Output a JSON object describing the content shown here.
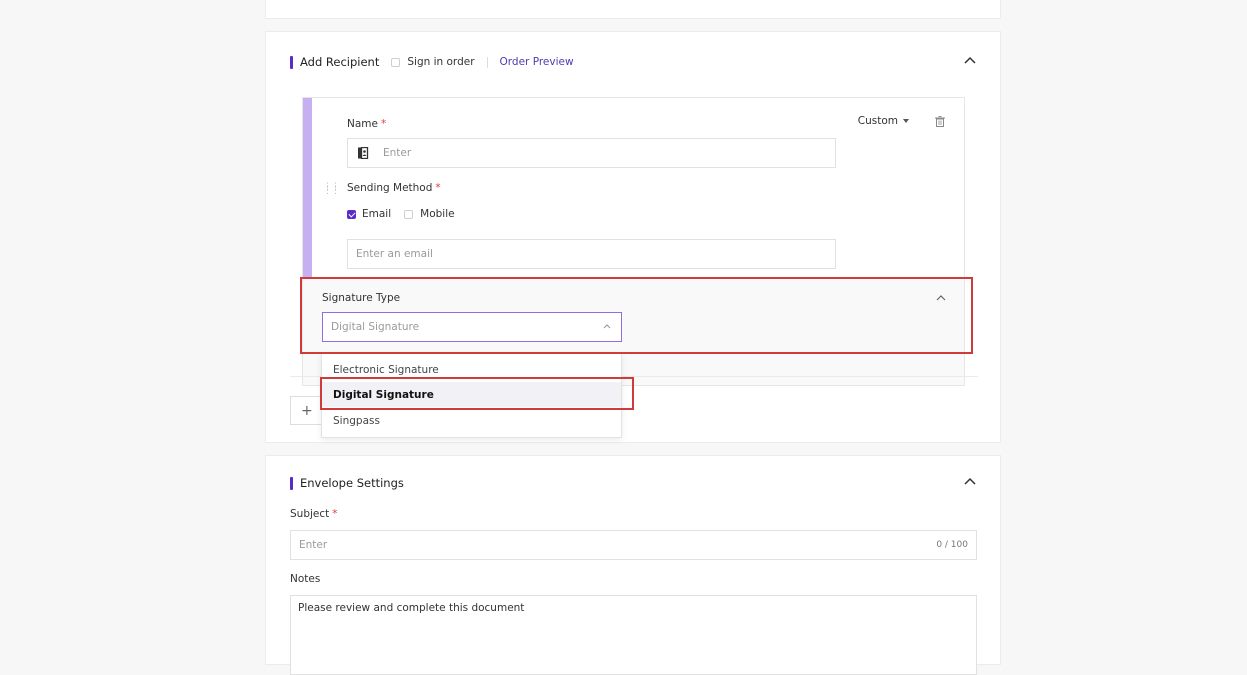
{
  "colors": {
    "accent": "#5b2bc9",
    "highlight": "#cf3a3a",
    "required": "#e23b3b",
    "stripe": "#c7b0f2"
  },
  "recipient_section": {
    "title": "Add Recipient",
    "sign_in_order_label": "Sign in order",
    "order_preview_link": "Order Preview",
    "recipient": {
      "role_dropdown": "Custom",
      "name_label": "Name",
      "name_placeholder": "Enter",
      "sending_method_label": "Sending Method",
      "methods": [
        {
          "label": "Email",
          "checked": true
        },
        {
          "label": "Mobile",
          "checked": false
        }
      ],
      "email_placeholder": "Enter an email",
      "signature_type_label": "Signature Type",
      "signature_type_value": "Digital Signature"
    },
    "add_button": "+"
  },
  "signature_dropdown": {
    "options": [
      "Electronic Signature",
      "Digital Signature",
      "Singpass"
    ],
    "selected": "Digital Signature"
  },
  "envelope_section": {
    "title": "Envelope Settings",
    "subject_label": "Subject",
    "subject_placeholder": "Enter",
    "subject_count": "0 / 100",
    "notes_label": "Notes",
    "notes_value": "Please review and complete this document"
  },
  "icons": [
    "chevron-up-icon",
    "trash-icon",
    "contact-book-icon",
    "drag-handle-icon",
    "caret-down-icon",
    "plus-icon"
  ]
}
